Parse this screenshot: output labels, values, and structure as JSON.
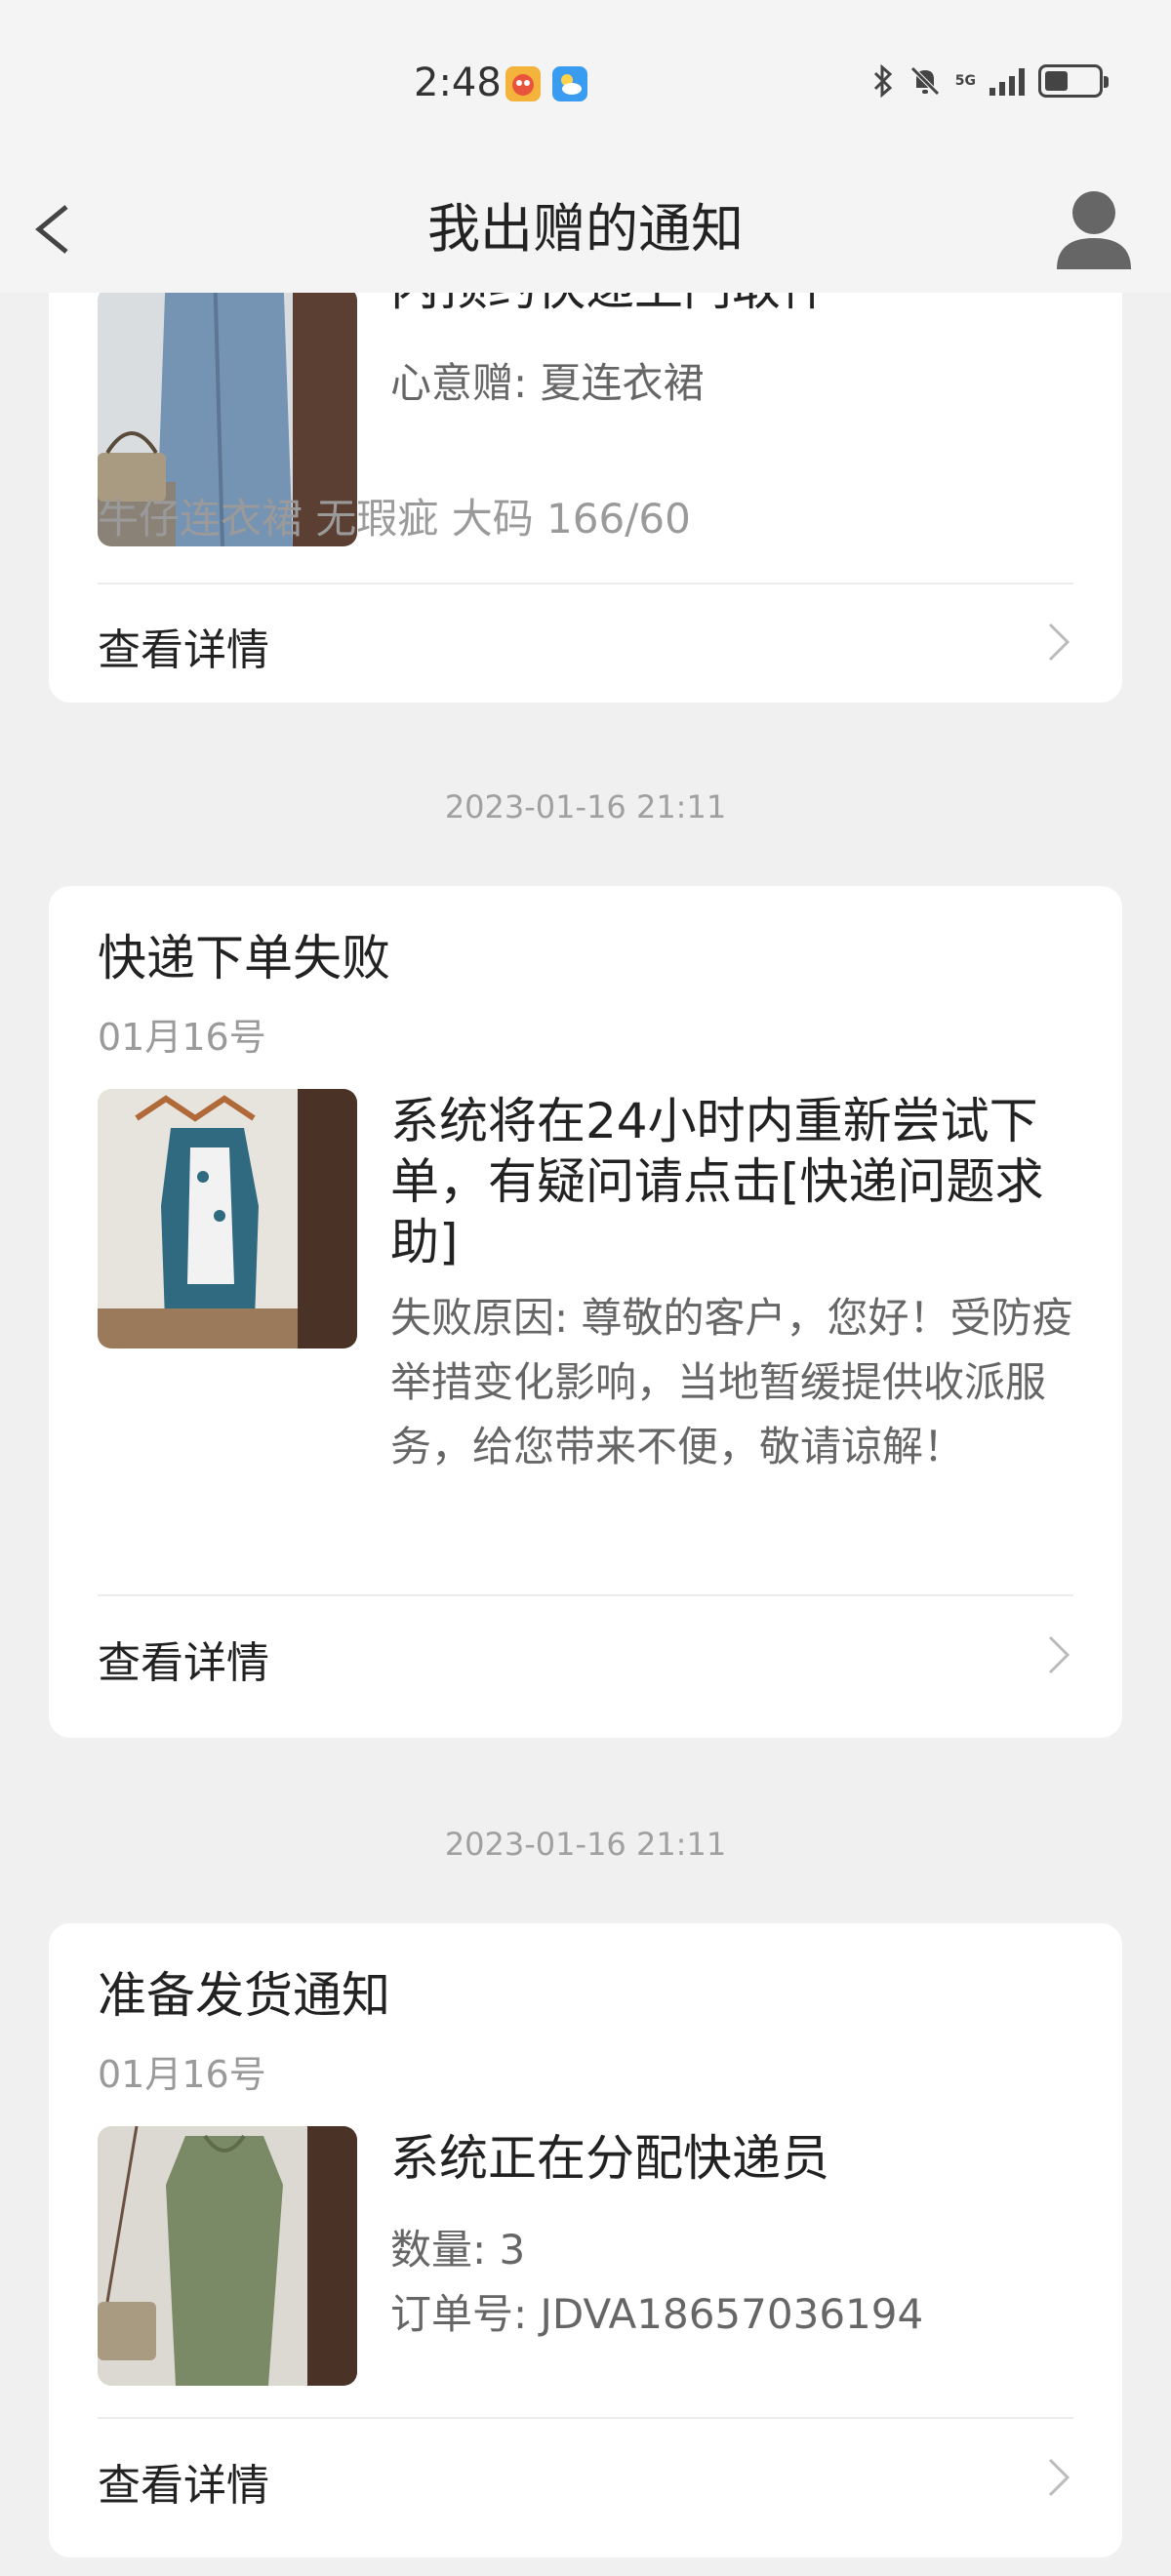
{
  "status_bar": {
    "time": "2:48",
    "network": "5G",
    "battery_level": 0.45,
    "icons": [
      "app-icon",
      "weather-icon",
      "bluetooth-icon",
      "mute-bell-icon",
      "signal-icon",
      "battery-icon"
    ]
  },
  "header": {
    "title": "我出赠的通知",
    "back_icon": "back-arrow-icon",
    "profile_icon": "profile-icon"
  },
  "cards": [
    {
      "headline_partial": "内预约快递上门取件",
      "gift_line": "心意赠: 夏连衣裙",
      "description": "牛仔连衣裙 无瑕疵 大码 166/60",
      "detail_label": "查看详情"
    },
    {
      "timestamp": "2023-01-16 21:11",
      "title": "快递下单失败",
      "date": "01月16号",
      "headline": "系统将在24小时内重新尝试下单，有疑问请点击[快递问题求助]",
      "body": "失败原因: 尊敬的客户，您好！受防疫举措变化影响，当地暂缓提供收派服务，给您带来不便，敬请谅解！",
      "detail_label": "查看详情"
    },
    {
      "timestamp": "2023-01-16 21:11",
      "title": "准备发货通知",
      "date": "01月16号",
      "headline": "系统正在分配快递员",
      "quantity": "数量: 3",
      "order": "订单号: JDVA18657036194",
      "detail_label": "查看详情"
    }
  ],
  "colors": {
    "background": "#f0f0f0",
    "card": "#ffffff",
    "muted_text": "#9a9a9a"
  }
}
